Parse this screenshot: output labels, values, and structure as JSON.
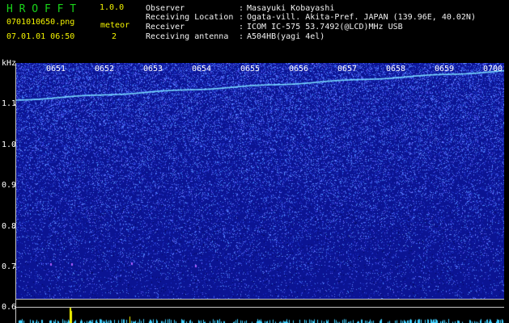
{
  "header": {
    "app_title": "H R O F F T",
    "version": "1.0.0",
    "filename": "0701010650.png",
    "datetime": "07.01.01 06:50",
    "meteor_label": "meteor",
    "meteor_count": "2"
  },
  "info": [
    {
      "key": "Observer",
      "sep": ":",
      "value": "Masayuki Kobayashi"
    },
    {
      "key": "Receiving Location",
      "sep": ":",
      "value": "Ogata-vill. Akita-Pref. JAPAN (139.96E, 40.02N)"
    },
    {
      "key": "Receiver",
      "sep": ":",
      "value": "ICOM IC-575 53.7492(@LCD)MHz USB"
    },
    {
      "key": "Receiving antenna",
      "sep": ":",
      "value": "A504HB(yagi 4el)"
    }
  ],
  "plot": {
    "unit_label": "kHz",
    "time_ticks": [
      "0651",
      "0652",
      "0653",
      "0654",
      "0655",
      "0656",
      "0657",
      "0658",
      "0659",
      "0700"
    ],
    "freq_ticks": [
      "1.1",
      "1.0",
      "0.9",
      "0.8",
      "0.7",
      "0.6"
    ],
    "colors": {
      "background": "#0b1493",
      "noise": "#4a6cff",
      "carrier": "#79d9ff",
      "level": "#f4f400",
      "level_base": "#40d0ff"
    }
  }
}
